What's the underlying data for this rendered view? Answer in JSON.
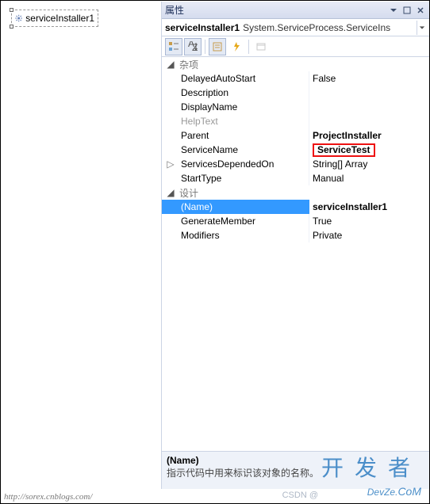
{
  "designer": {
    "component_label": "serviceInstaller1"
  },
  "panel": {
    "title": "属性",
    "object_name": "serviceInstaller1",
    "object_type": "System.ServiceProcess.ServiceIns"
  },
  "categories": [
    {
      "label": "杂项",
      "props": [
        {
          "name": "DelayedAutoStart",
          "value": "False"
        },
        {
          "name": "Description",
          "value": ""
        },
        {
          "name": "DisplayName",
          "value": ""
        },
        {
          "name": "HelpText",
          "value": "",
          "dim": true
        },
        {
          "name": "Parent",
          "value": "ProjectInstaller",
          "bold": true
        },
        {
          "name": "ServiceName",
          "value": "ServiceTest",
          "bold": true,
          "highlight": true
        },
        {
          "name": "ServicesDependedOn",
          "value": "String[] Array",
          "expander": true
        },
        {
          "name": "StartType",
          "value": "Manual"
        }
      ]
    },
    {
      "label": "设计",
      "props": [
        {
          "name": "(Name)",
          "value": "serviceInstaller1",
          "selected": true
        },
        {
          "name": "GenerateMember",
          "value": "True"
        },
        {
          "name": "Modifiers",
          "value": "Private"
        }
      ]
    }
  ],
  "description": {
    "name": "(Name)",
    "text": "指示代码中用来标识该对象的名称。"
  },
  "watermarks": {
    "footer_url": "http://sorex.cnblogs.com/",
    "cn": "开发者",
    "en_pre": "DevZe.",
    "en_suf": "CoM",
    "csdn": "CSDN @"
  }
}
